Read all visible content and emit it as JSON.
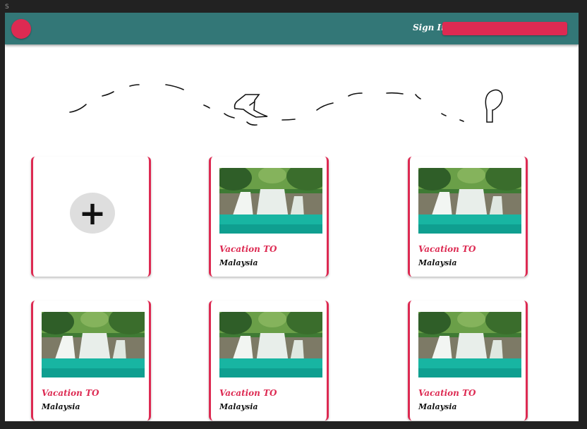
{
  "window": {
    "label": "S"
  },
  "header": {
    "sign_in_label": "Sign In",
    "accent_color": "#dd2a52",
    "bar_color": "#337777"
  },
  "add_card": {
    "icon": "plus-icon",
    "symbol": "+"
  },
  "cards": [
    {
      "title": "Vacation TO",
      "subtitle": "Malaysia"
    },
    {
      "title": "Vacation TO",
      "subtitle": "Malaysia"
    },
    {
      "title": "Vacation TO",
      "subtitle": "Malaysia"
    },
    {
      "title": "Vacation TO",
      "subtitle": "Malaysia"
    },
    {
      "title": "Vacation TO",
      "subtitle": "Malaysia"
    }
  ]
}
